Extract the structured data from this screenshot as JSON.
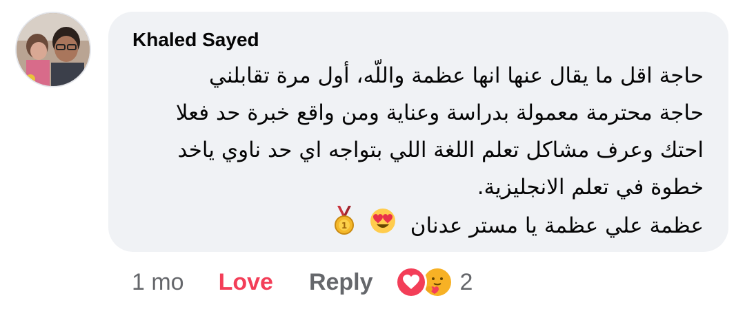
{
  "comment": {
    "author": "Khaled Sayed",
    "lines": [
      "حاجة اقل ما يقال عنها انها عظمة واللّه، أول مرة تقابلني",
      "حاجة محترمة معمولة بدراسة وعناية ومن واقع خبرة حد فعلا",
      "احتك وعرف مشاكل تعلم اللغة اللي بتواجه اي حد ناوي ياخد",
      "خطوة في تعلم الانجليزية.",
      "عظمة علي عظمة يا مستر عدنان"
    ],
    "emojis": [
      "heart-eyes-emoji",
      "gold-medal-emoji"
    ]
  },
  "actions": {
    "time": "1 mo",
    "love_label": "Love",
    "reply_label": "Reply",
    "reaction_count": "2",
    "reaction_icons": [
      "love-reaction-icon",
      "care-reaction-icon"
    ]
  },
  "colors": {
    "bubble_bg": "#f0f2f5",
    "love": "#f33e58",
    "secondary_text": "#65676b",
    "primary_text": "#050505"
  }
}
